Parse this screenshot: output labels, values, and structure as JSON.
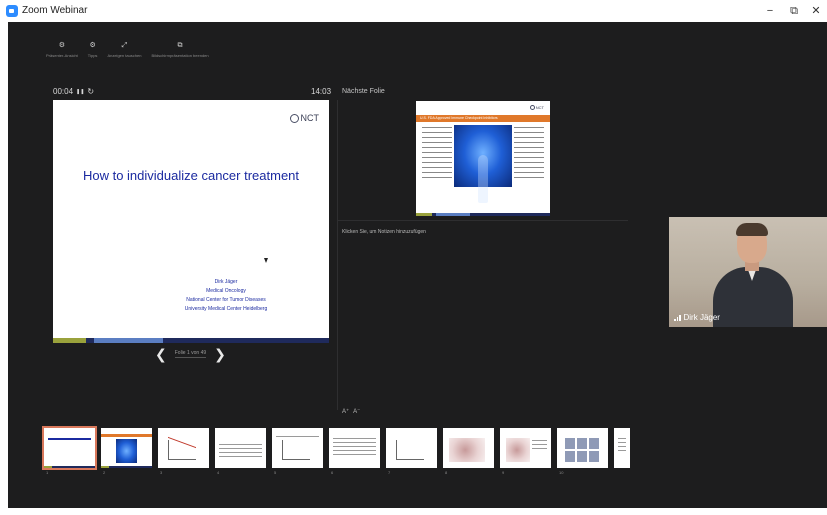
{
  "window": {
    "title": "Zoom Webinar",
    "controls": {
      "minimize": "−",
      "restore": "⧉",
      "close": "✕"
    }
  },
  "presenter_tools": [
    {
      "icon": "pointer-icon",
      "glyph": "⚙",
      "label": "Präsenter-Ansicht"
    },
    {
      "icon": "pen-icon",
      "glyph": "⚙",
      "label": "Tipps"
    },
    {
      "icon": "screen-swap-icon",
      "glyph": "⤢",
      "label": "Anzeigen tauschen"
    },
    {
      "icon": "slideshow-icon",
      "glyph": "⧉",
      "label": "Bildschirmpräsentation beenden"
    }
  ],
  "timer": {
    "elapsed": "00:04",
    "pause_glyph": "❚❚",
    "reset_glyph": "↻"
  },
  "clock": "14:03",
  "current_slide": {
    "logo_text": "NCT",
    "title": "How to individualize cancer treatment",
    "author_lines": [
      "Dirk Jäger",
      "Medical Oncology",
      "National Center for Tumor Diseases",
      "University Medical Center Heidelberg"
    ],
    "footer_colors": [
      "#9aa23c",
      "#1f2a5c",
      "#5b7ec2",
      "#1f2a5c"
    ]
  },
  "slide_nav": {
    "prev_glyph": "❮",
    "next_glyph": "❯",
    "label": "Folie 1 von 49"
  },
  "next_slide": {
    "heading": "Nächste Folie",
    "logo_text": "NCT",
    "title": "U.S. FDA Approved Immune Checkpoint Inhibitors"
  },
  "notes": {
    "placeholder": "Klicken Sie, um Notizen hinzuzufügen"
  },
  "font_controls": {
    "increase": "A⁺",
    "decrease": "A⁻"
  },
  "video": {
    "participant_name": "Dirk Jäger"
  },
  "filmstrip": {
    "thumbnails": [
      {
        "number": "1",
        "kind": "title",
        "selected": true
      },
      {
        "number": "2",
        "kind": "body-image",
        "selected": false
      },
      {
        "number": "3",
        "kind": "chart",
        "selected": false
      },
      {
        "number": "4",
        "kind": "text",
        "selected": false
      },
      {
        "number": "5",
        "kind": "chart",
        "selected": false
      },
      {
        "number": "6",
        "kind": "text",
        "selected": false
      },
      {
        "number": "7",
        "kind": "chart",
        "selected": false
      },
      {
        "number": "8",
        "kind": "histology",
        "selected": false
      },
      {
        "number": "9",
        "kind": "histology",
        "selected": false
      },
      {
        "number": "10",
        "kind": "grid",
        "selected": false
      },
      {
        "number": "11",
        "kind": "partial",
        "selected": false
      }
    ]
  },
  "colors": {
    "stage_background": "#1d1d1e",
    "selected_thumbnail": "#d9785b",
    "slide_title_blue": "#1b2aa0",
    "next_slide_banner": "#e0782a"
  }
}
